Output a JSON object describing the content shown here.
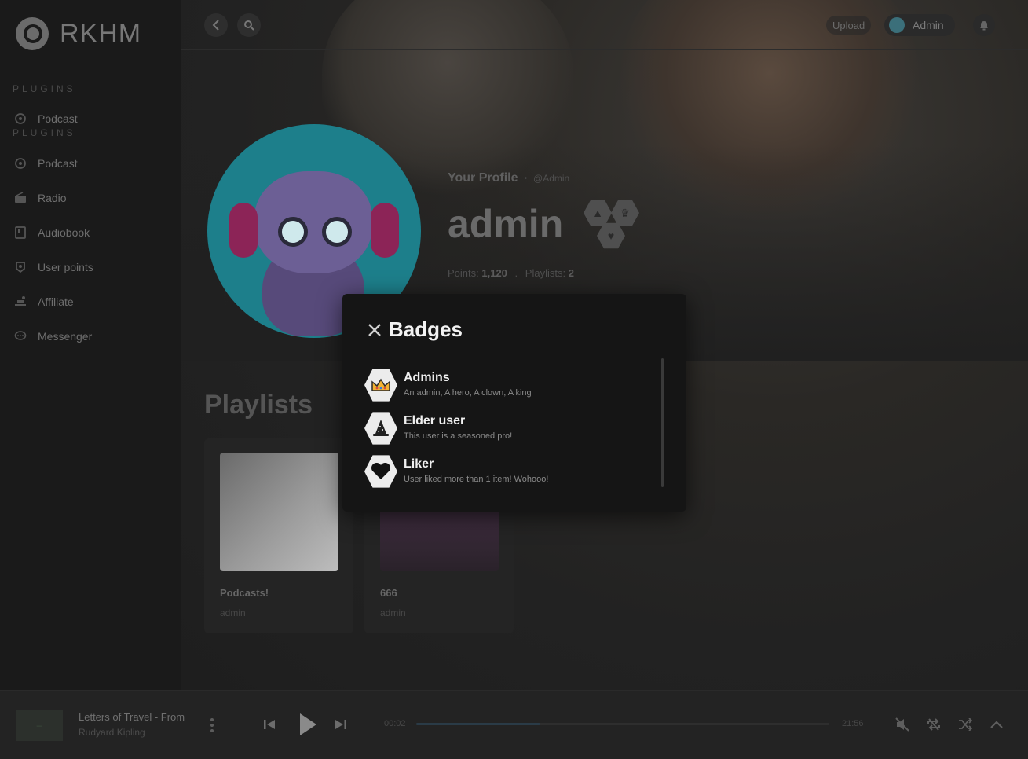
{
  "app": {
    "name": "RKHM"
  },
  "sidebar": {
    "section_label": "PLUGINS",
    "ghost_item": "Podcast",
    "items": [
      {
        "label": "Podcast",
        "icon": "podcast-icon"
      },
      {
        "label": "Radio",
        "icon": "radio-icon"
      },
      {
        "label": "Audiobook",
        "icon": "audiobook-icon"
      },
      {
        "label": "User points",
        "icon": "user-points-icon"
      },
      {
        "label": "Affiliate",
        "icon": "affiliate-icon"
      },
      {
        "label": "Messenger",
        "icon": "messenger-icon"
      }
    ]
  },
  "topbar": {
    "upload_label": "Upload",
    "user_label": "Admin"
  },
  "profile": {
    "subtitle": "Your Profile",
    "handle": "@Admin",
    "name": "admin",
    "points_label": "Points:",
    "points_value": "1,120",
    "playlists_label": "Playlists:",
    "playlists_value": "2"
  },
  "playlists": {
    "title": "Playlists",
    "items": [
      {
        "name": "Podcasts!",
        "owner": "admin"
      },
      {
        "name": "666",
        "owner": "admin"
      }
    ]
  },
  "player": {
    "track_title": "Letters of Travel - From",
    "artist": "Rudyard Kipling",
    "time_elapsed": "00:02",
    "time_total": "21:56",
    "progress": 0.3
  },
  "modal": {
    "title": "Badges",
    "badges": [
      {
        "name": "Admins",
        "description": "An admin, A hero, A clown, A king",
        "icon": "crown-icon"
      },
      {
        "name": "Elder user",
        "description": "This user is a seasoned pro!",
        "icon": "wizard-hat-icon"
      },
      {
        "name": "Liker",
        "description": "User liked more than 1 item! Wohooo!",
        "icon": "heart-icon"
      }
    ]
  }
}
